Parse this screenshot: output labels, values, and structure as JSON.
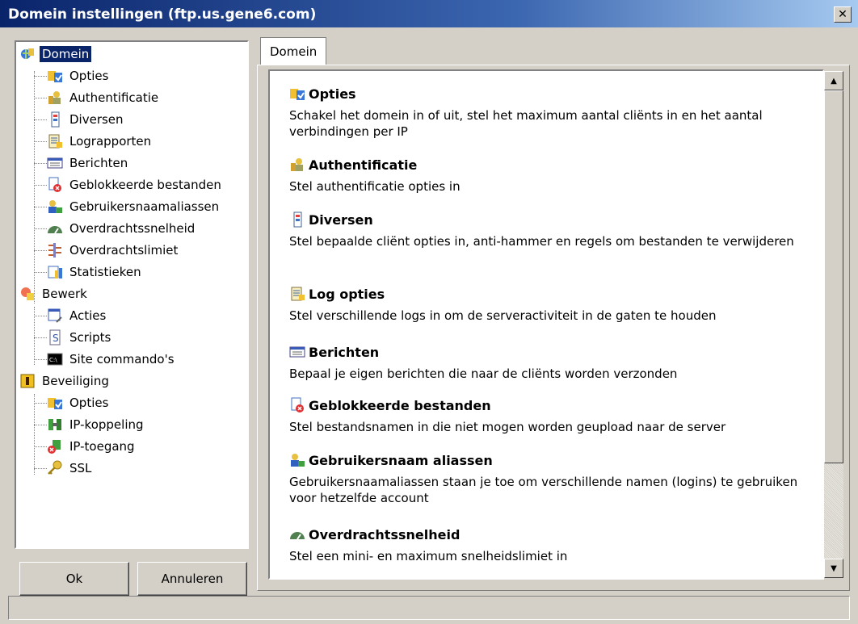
{
  "window": {
    "title": "Domein instellingen (ftp.us.gene6.com)",
    "close_glyph": "✕"
  },
  "tree": [
    {
      "label": "Domein",
      "icon": "domain-globe-icon",
      "selected": true
    },
    {
      "label": "Opties",
      "icon": "options-icon"
    },
    {
      "label": "Authentificatie",
      "icon": "keys-user-icon"
    },
    {
      "label": "Diversen",
      "icon": "misc-icon"
    },
    {
      "label": "Lograpporten",
      "icon": "log-icon"
    },
    {
      "label": "Berichten",
      "icon": "messages-icon"
    },
    {
      "label": "Geblokkeerde bestanden",
      "icon": "blocked-file-icon"
    },
    {
      "label": "Gebruikersnaamaliassen",
      "icon": "user-alias-icon"
    },
    {
      "label": "Overdrachtssnelheid",
      "icon": "speed-gauge-icon"
    },
    {
      "label": "Overdrachtslimiet",
      "icon": "transfer-limit-icon"
    },
    {
      "label": "Statistieken",
      "icon": "statistics-icon"
    },
    {
      "label": "Bewerk",
      "icon": "edit-icon"
    },
    {
      "label": "Acties",
      "icon": "actions-icon"
    },
    {
      "label": "Scripts",
      "icon": "scripts-icon"
    },
    {
      "label": "Site commando's",
      "icon": "command-prompt-icon"
    },
    {
      "label": "Beveiliging",
      "icon": "security-lock-icon"
    },
    {
      "label": "Opties",
      "icon": "options-icon"
    },
    {
      "label": "IP-koppeling",
      "icon": "ip-binding-icon"
    },
    {
      "label": "IP-toegang",
      "icon": "ip-access-icon"
    },
    {
      "label": "SSL",
      "icon": "ssl-key-icon"
    }
  ],
  "buttons": {
    "ok": "Ok",
    "cancel": "Annuleren"
  },
  "tab": {
    "label": "Domein"
  },
  "sections": [
    {
      "title": "Opties",
      "icon": "options-icon",
      "desc": "Schakel het domein in of uit, stel het maximum aantal cliënts in en het aantal verbindingen per IP"
    },
    {
      "title": "Authentificatie",
      "icon": "keys-user-icon",
      "desc": "Stel authentificatie opties in"
    },
    {
      "title": "Diversen",
      "icon": "misc-icon",
      "desc": "Stel bepaalde cliënt opties in, anti-hammer en regels om bestanden te verwijderen"
    },
    {
      "title": "Log opties",
      "icon": "log-icon",
      "desc": "Stel verschillende logs in om de serveractiviteit in de gaten te houden"
    },
    {
      "title": "Berichten",
      "icon": "messages-icon",
      "desc": "Bepaal je eigen berichten die naar de cliënts worden verzonden"
    },
    {
      "title": "Geblokkeerde bestanden",
      "icon": "blocked-file-icon",
      "desc": "Stel bestandsnamen in die niet mogen worden geupload naar de server"
    },
    {
      "title": "Gebruikersnaam aliassen",
      "icon": "user-alias-icon",
      "desc": "Gebruikersnaamaliassen staan je toe om verschillende namen (logins) te gebruiken voor hetzelfde account"
    },
    {
      "title": "Overdrachtssnelheid",
      "icon": "speed-gauge-icon",
      "desc": "Stel een mini- en maximum snelheidslimiet in"
    }
  ],
  "scrollbar": {
    "up_glyph": "▲",
    "down_glyph": "▼"
  },
  "colors": {
    "titlebar": "#0a246a",
    "selection": "#0a246a",
    "face": "#d4d0c8"
  }
}
